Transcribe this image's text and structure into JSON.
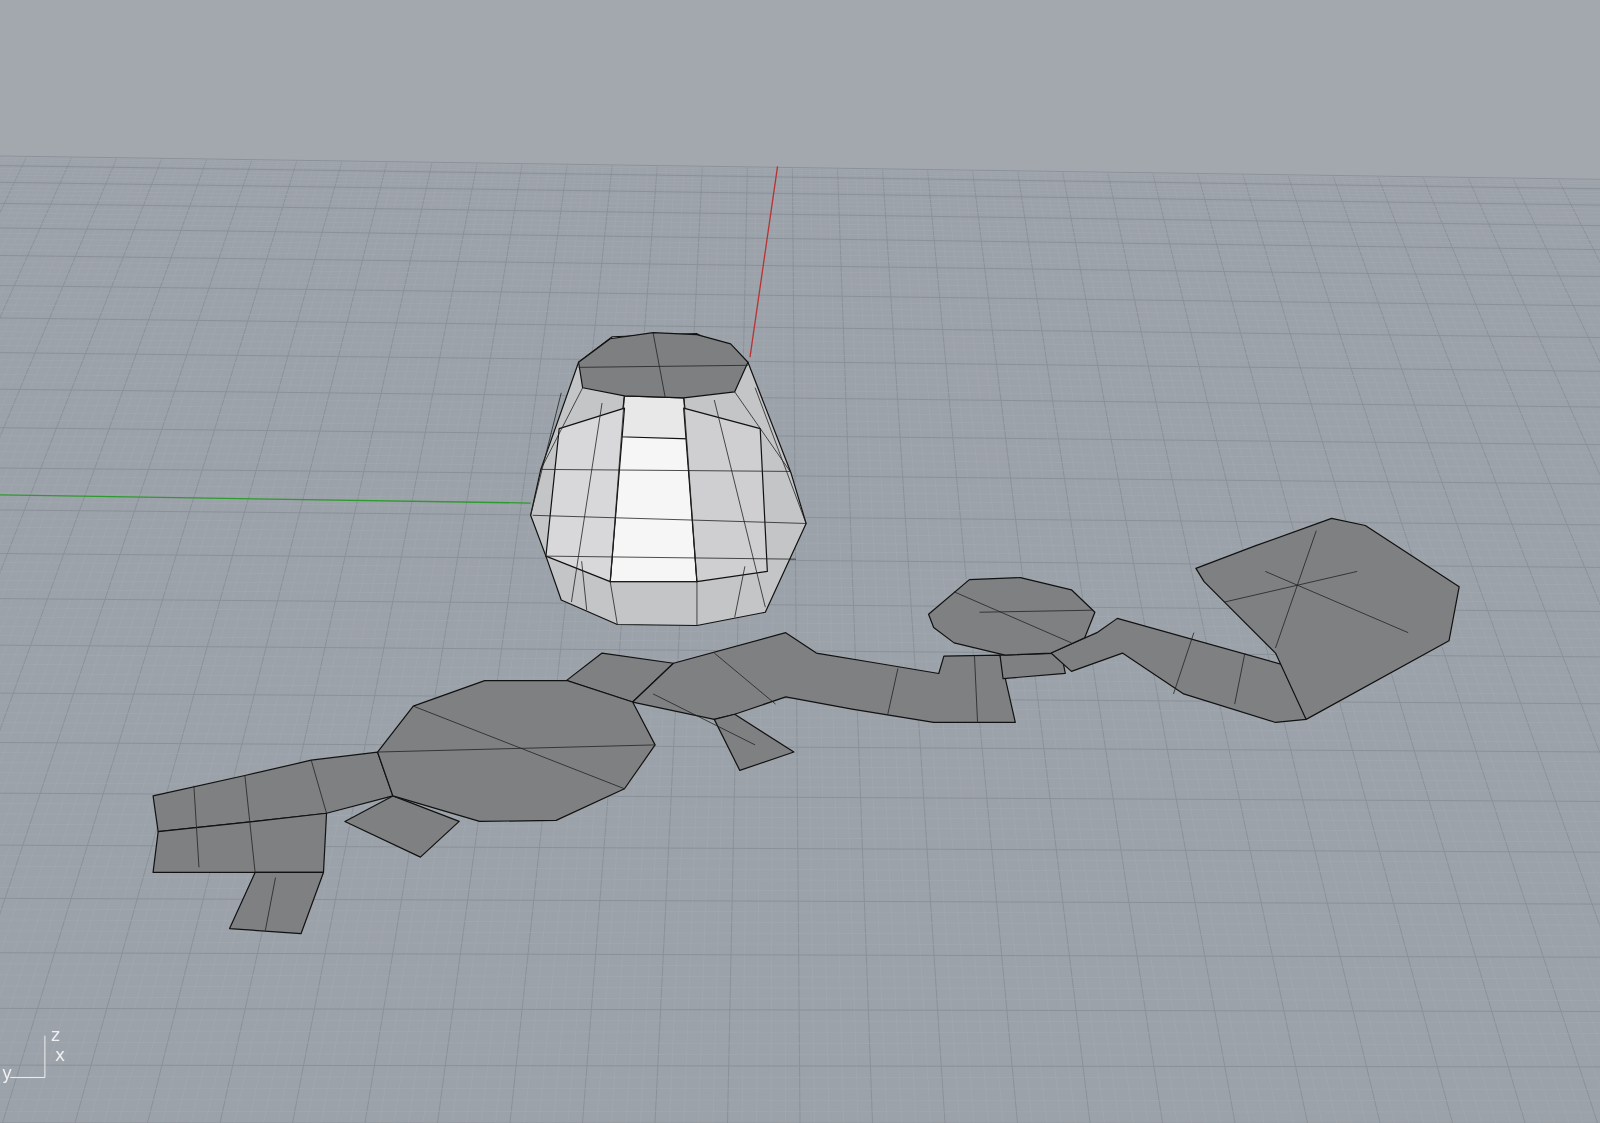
{
  "viewport": {
    "axis_labels": [
      "z",
      "x",
      "y"
    ]
  }
}
